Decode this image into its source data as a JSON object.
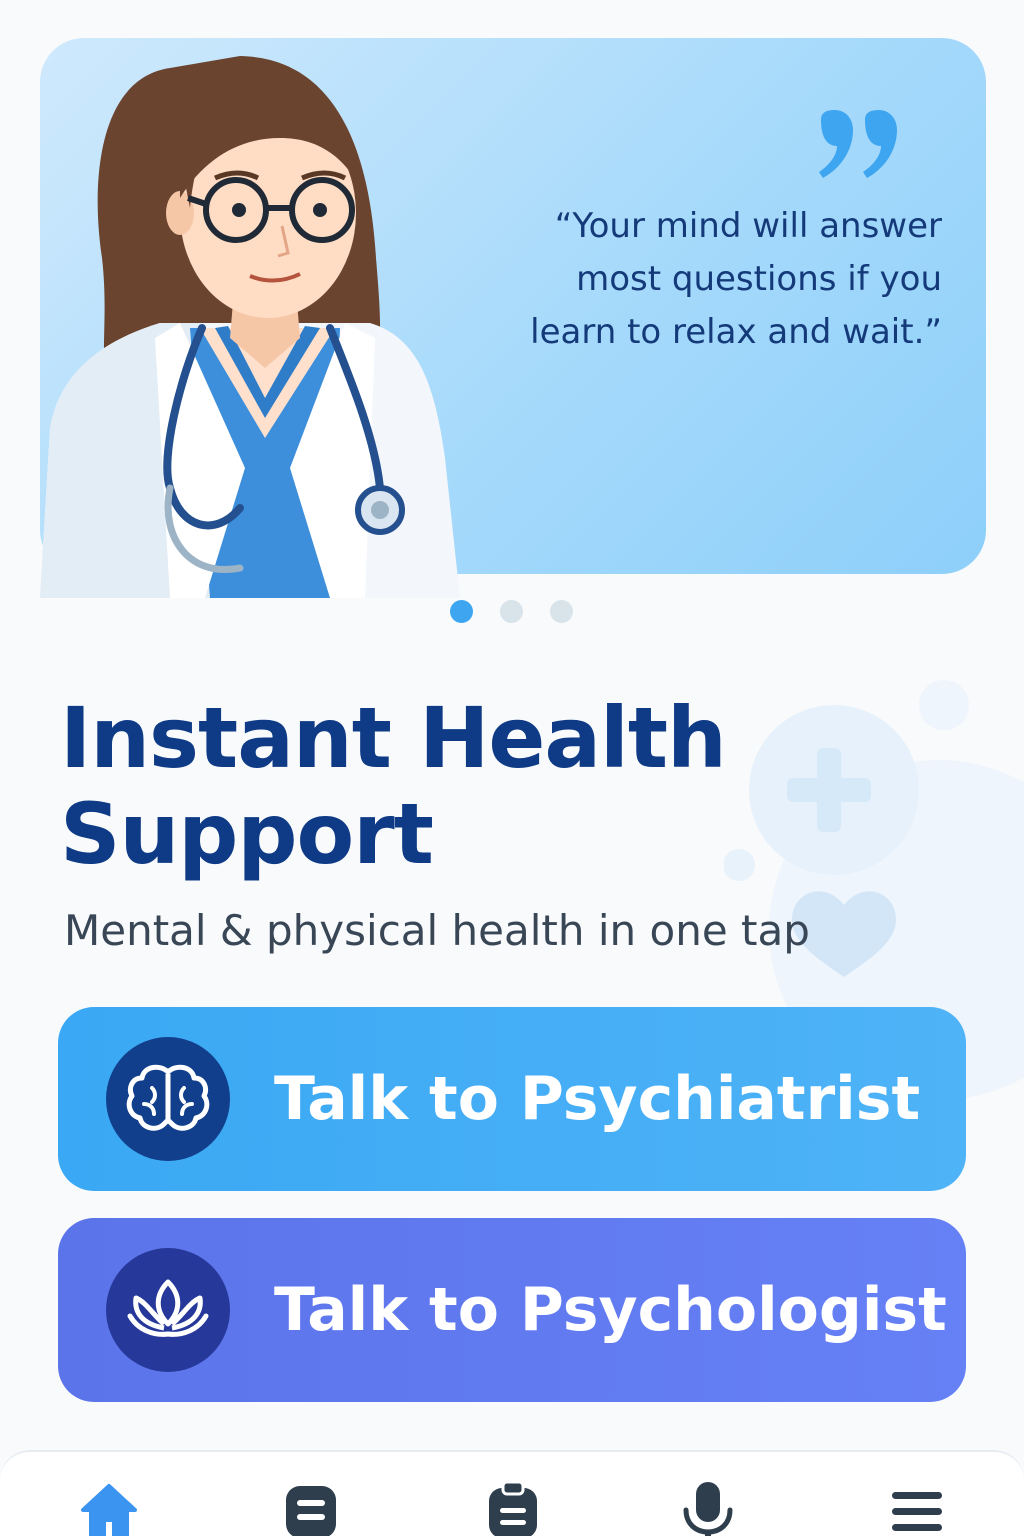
{
  "hero": {
    "quote": "“Your mind will answer most questions if you learn to relax and wait.”",
    "slides_total": 3,
    "active_slide": 1
  },
  "main": {
    "title": "Instant Health Support",
    "subtitle": "Mental & physical health in one tap"
  },
  "actions": [
    {
      "label": "Talk to Psychiatrist",
      "icon": "brain-icon",
      "color": "#41acf5"
    },
    {
      "label": "Talk to Psychologist",
      "icon": "lotus-icon",
      "color": "#6079ef"
    }
  ],
  "bottom_nav": {
    "items": [
      "home-icon",
      "records-icon",
      "clipboard-icon",
      "microphone-icon",
      "menu-icon"
    ],
    "active": "home-icon"
  },
  "colors": {
    "primary_dark": "#0e3a86",
    "accent_blue": "#3ea6f1",
    "accent_indigo": "#6079ef",
    "nav_active": "#3b95f0",
    "nav_inactive": "#2e3e4d"
  }
}
